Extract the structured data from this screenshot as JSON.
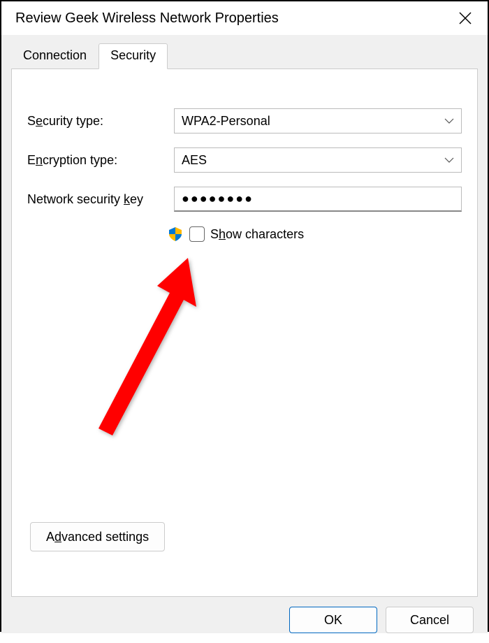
{
  "window": {
    "title": "Review Geek Wireless Network Properties"
  },
  "tabs": {
    "connection": "Connection",
    "security": "Security",
    "active": "Security"
  },
  "form": {
    "securityType": {
      "label_pre": "S",
      "label_u": "e",
      "label_post": "curity type:",
      "value": "WPA2-Personal"
    },
    "encryptionType": {
      "label_pre": "E",
      "label_u": "n",
      "label_post": "cryption type:",
      "value": "AES"
    },
    "networkKey": {
      "label_pre": "Network security ",
      "label_u": "k",
      "label_post": "ey",
      "value_masked": "●●●●●●●●"
    },
    "showCharacters": {
      "label_pre": "S",
      "label_u": "h",
      "label_post": "ow characters",
      "checked": false
    }
  },
  "buttons": {
    "advanced_pre": "A",
    "advanced_u": "d",
    "advanced_post": "vanced settings",
    "ok": "OK",
    "cancel": "Cancel"
  }
}
